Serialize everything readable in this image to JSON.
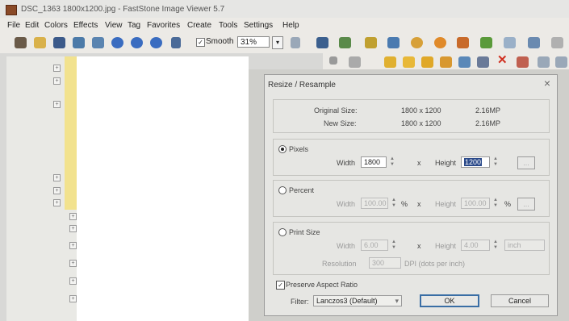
{
  "window": {
    "title": "DSC_1363 1800x1200.jpg - FastStone Image Viewer 5.7"
  },
  "menu": [
    "File",
    "Edit",
    "Colors",
    "Effects",
    "View",
    "Tag",
    "Favorites",
    "Create",
    "Tools",
    "Settings",
    "Help"
  ],
  "toolbar": {
    "smooth_label": "Smooth",
    "zoom_value": "31%"
  },
  "dialog": {
    "title": "Resize / Resample",
    "close": "×",
    "original_size_label": "Original Size:",
    "original_size_value": "1800 x 1200",
    "original_size_mp": "2.16MP",
    "new_size_label": "New Size:",
    "new_size_value": "1800 x 1200",
    "new_size_mp": "2.16MP",
    "pixels": {
      "label": "Pixels",
      "width_label": "Width",
      "width_value": "1800",
      "x": "x",
      "height_label": "Height",
      "height_value": "1200",
      "extra_button": "..."
    },
    "percent": {
      "label": "Percent",
      "width_label": "Width",
      "width_value": "100.00",
      "pct": "%",
      "x": "x",
      "height_label": "Height",
      "height_value": "100.00",
      "pct2": "%",
      "extra_button": "..."
    },
    "print": {
      "label": "Print Size",
      "width_label": "Width",
      "width_value": "6.00",
      "x": "x",
      "height_label": "Height",
      "height_value": "4.00",
      "unit": "inch",
      "resolution_label": "Resolution",
      "resolution_value": "300",
      "dpi_label": "DPI (dots per inch)"
    },
    "preserve_label": "Preserve Aspect Ratio",
    "filter_label": "Filter:",
    "filter_value": "Lanczos3 (Default)",
    "ok": "OK",
    "cancel": "Cancel"
  }
}
